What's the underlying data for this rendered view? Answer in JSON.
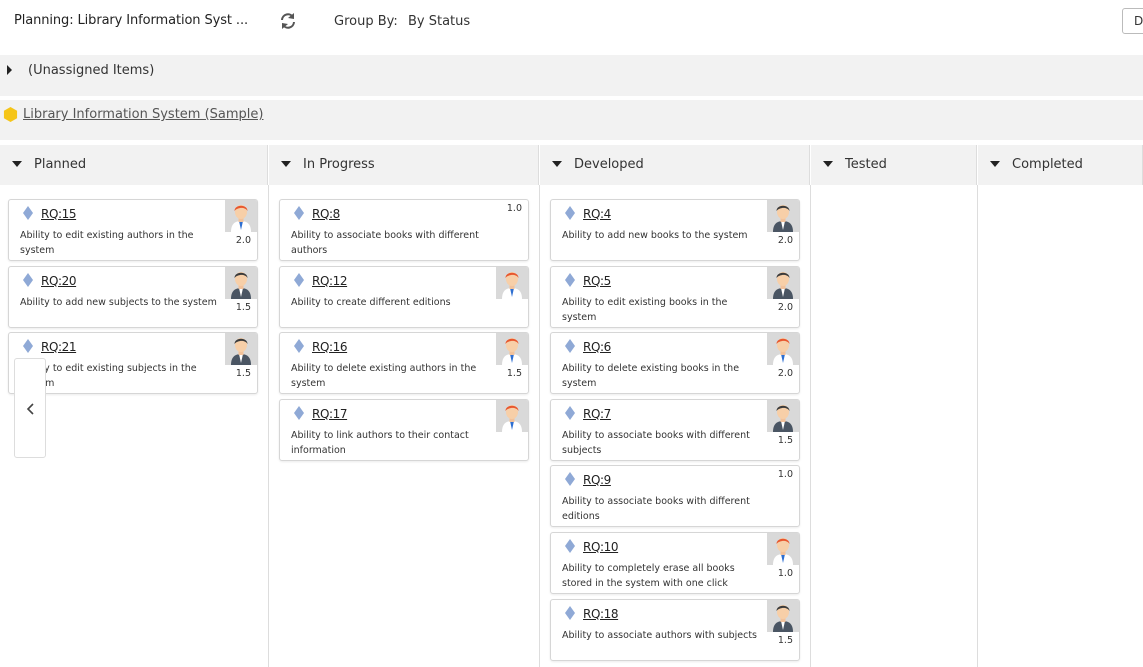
{
  "header": {
    "title": "Planning: Library Information Syst ...",
    "group_by_label": "Group By:",
    "group_by_value": "By Status",
    "button_label": "D"
  },
  "unassigned": {
    "label": "(Unassigned Items)"
  },
  "project": {
    "label": "Library Information System (Sample)",
    "icon_color": "#f5c518"
  },
  "colors": {
    "diamond": "#8fa9d6",
    "header_bg": "#f2f2f2"
  },
  "columns": [
    {
      "label": "Planned",
      "cards": [
        {
          "id": "RQ:15",
          "desc": "Ability to edit existing authors in the system",
          "avatar": "red-hair-person-icon",
          "estimate": "2.0"
        },
        {
          "id": "RQ:20",
          "desc": "Ability to add new subjects to the system",
          "avatar": "dark-hair-person-icon",
          "estimate": "1.5"
        },
        {
          "id": "RQ:21",
          "desc": "Ability to edit existing subjects in the system",
          "avatar": "dark-hair-person-icon",
          "estimate": "1.5"
        }
      ]
    },
    {
      "label": "In Progress",
      "cards": [
        {
          "id": "RQ:8",
          "desc": "Ability to associate books with different authors",
          "avatar": "",
          "estimate": "1.0"
        },
        {
          "id": "RQ:12",
          "desc": "Ability to create different editions",
          "avatar": "red-hair-person-icon",
          "estimate": ""
        },
        {
          "id": "RQ:16",
          "desc": "Ability to delete existing authors in the system",
          "avatar": "red-hair-person-icon",
          "estimate": "1.5"
        },
        {
          "id": "RQ:17",
          "desc": "Ability to link authors to their contact information",
          "avatar": "red-hair-person-icon",
          "estimate": ""
        }
      ]
    },
    {
      "label": "Developed",
      "cards": [
        {
          "id": "RQ:4",
          "desc": "Ability to add new books to the system",
          "avatar": "dark-hair-person-icon",
          "estimate": "2.0"
        },
        {
          "id": "RQ:5",
          "desc": "Ability to edit existing books in the system",
          "avatar": "dark-hair-person-icon",
          "estimate": "2.0"
        },
        {
          "id": "RQ:6",
          "desc": "Ability to delete existing books in the system",
          "avatar": "red-hair-person-icon",
          "estimate": "2.0"
        },
        {
          "id": "RQ:7",
          "desc": "Ability to associate books with different subjects",
          "avatar": "dark-hair-person-icon",
          "estimate": "1.5"
        },
        {
          "id": "RQ:9",
          "desc": "Ability to associate books with different editions",
          "avatar": "",
          "estimate": "1.0"
        },
        {
          "id": "RQ:10",
          "desc": "Ability to completely erase all books stored in the system with one click",
          "avatar": "red-hair-person-icon",
          "estimate": "1.0"
        },
        {
          "id": "RQ:18",
          "desc": "Ability to associate authors with subjects",
          "avatar": "dark-hair-person-icon",
          "estimate": "1.5"
        }
      ]
    },
    {
      "label": "Tested",
      "cards": []
    },
    {
      "label": "Completed",
      "cards": []
    }
  ]
}
